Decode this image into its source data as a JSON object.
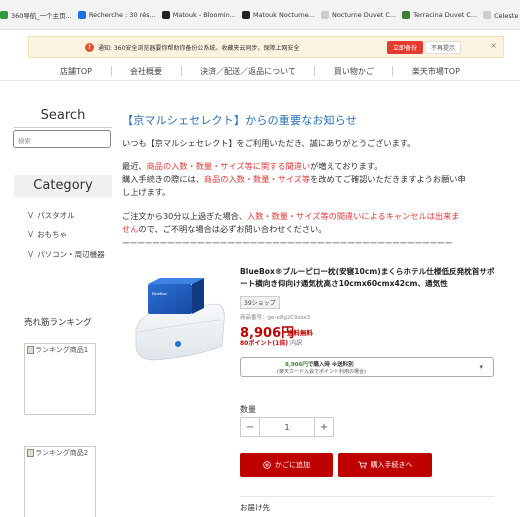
{
  "bookmarks": [
    {
      "label": "360导航_一个主页...",
      "color": "#2f9b3a"
    },
    {
      "label": "Recherche : 30 rés...",
      "color": "#1a73e8"
    },
    {
      "label": "Matouk - Bloomin...",
      "color": "#222222"
    },
    {
      "label": "Matouk Nocturne...",
      "color": "#222222"
    },
    {
      "label": "Nocturne Duvet C...",
      "color": "#cccccc"
    },
    {
      "label": "Terracina Duvet C...",
      "color": "#3a7f3a"
    },
    {
      "label": "Celeste 系列 - 奢华...",
      "color": "#cccccc"
    }
  ],
  "notification": {
    "text": "通知: 360安全浏览器要你帮助你备份公系统。收藏夹云同步，保障上网安全",
    "primary_button": "立即备份",
    "secondary_button": "不再提示",
    "close": "×"
  },
  "nav": [
    "店舗TOP",
    "会社概要",
    "決済／配送／返品について",
    "買い物かご",
    "楽天市場TOP"
  ],
  "sidebar": {
    "search_title": "Search",
    "search_placeholder": "検索",
    "category_title": "Category",
    "categories": [
      "パスタオル",
      "おもちゃ",
      "パソコン・周辺機器"
    ],
    "category_marker": "V",
    "ranking_title": "売れ筋ランキング",
    "ranking_items": [
      "ランキング商品1",
      "ランキング商品2"
    ]
  },
  "notice": {
    "title": "【京マルシェセレクト】からの重要なお知らせ",
    "line1": "いつも【京マルシェセレクト】をご利用いただき、誠にありがとうございます。",
    "line2_pre": "最近、",
    "line2_red": "商品の入数・数量・サイズ等に関する間違い",
    "line2_post": "が増えております。",
    "line3_pre": "購入手続きの際には、",
    "line3_red": "商品の入数・数量・サイズ等",
    "line3_post": "を改めてご確認いただきますようお願い申",
    "line4": "し上げます。",
    "line5_pre": "ご注文から30分以上過ぎた場合、",
    "line5_red": "入数・数量・サイズ等の間違いによるキャンセルは出来ま",
    "line6_red": "せん",
    "line6_post": "ので、ご不明な場合は必ずお問い合わせください。",
    "divider": "ーーーーーーーーーーーーーーーーーーーーーーーーーーーーーーーーーーーーーーーーーーーー"
  },
  "product": {
    "name": "BlueBox®ブルーピロー枕(安寝10cm)まくらホテル仕様低反発枕首サポート横向き仰向け通気枕高さ10cmx60cmx42cm、通気性",
    "shop_tag": "39ショップ",
    "code": "商品番号：go-e8g2C9zsx3",
    "price": "8,906円",
    "shipping": "送料無料",
    "points": "80ポイント(1倍)",
    "points_detail": "内訳",
    "pay_line1_amount": "8,906円",
    "pay_line1_text": "で購入時 ※送料別",
    "pay_line2": "(楽天カード入会でポイント利用の場合)",
    "quantity_label": "数量",
    "quantity_value": "1",
    "minus": "−",
    "plus": "+",
    "cart_button": "かごに追加",
    "buy_button": "購入手続きへ",
    "delivery_label": "お届け先",
    "image_box_label": "BlueBox"
  },
  "colors": {
    "accent_red": "#bf0000",
    "notice_blue": "#2a6fb5",
    "highlight_red": "#e03a3a"
  }
}
